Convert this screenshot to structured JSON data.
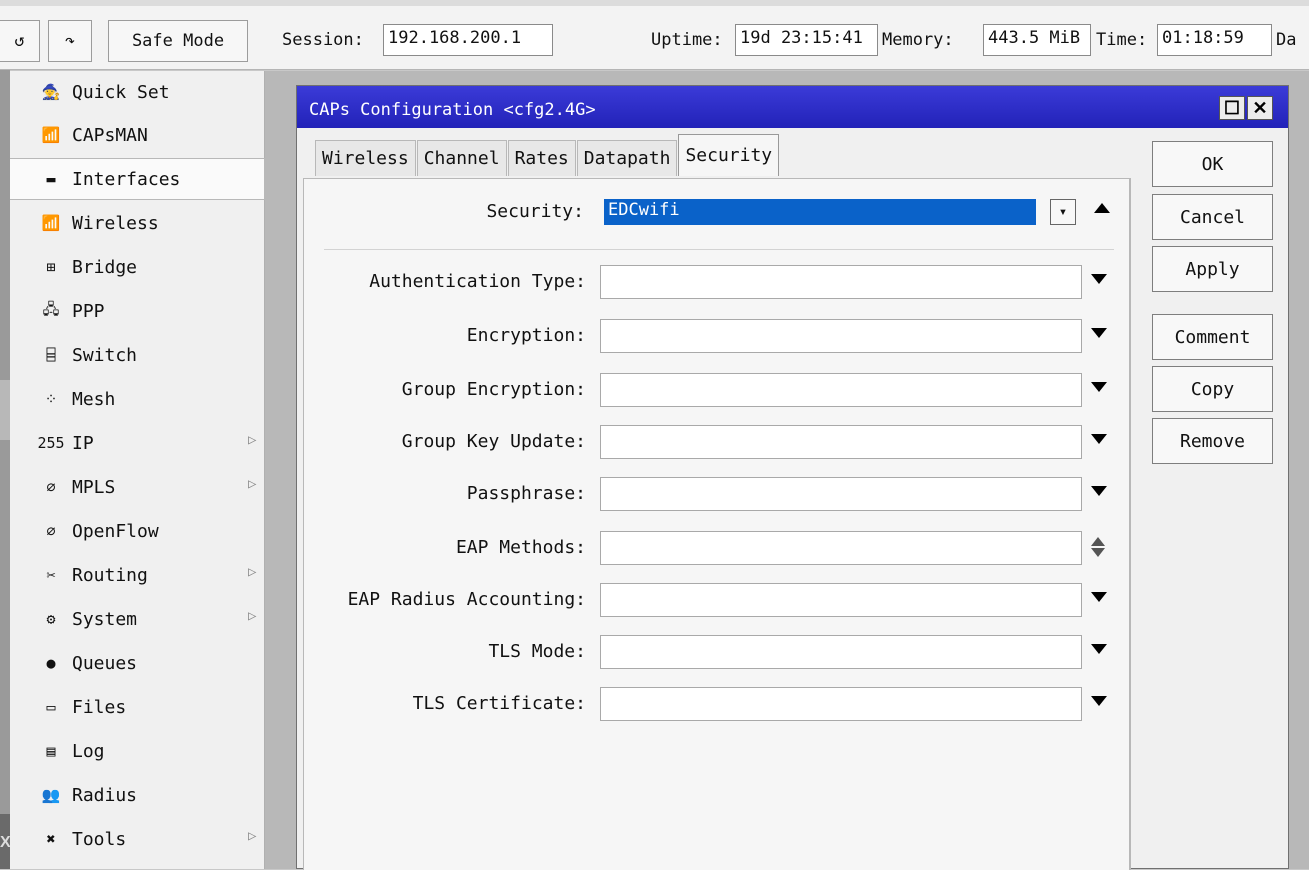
{
  "toolbar": {
    "undo_label": "↺",
    "redo_label": "↷",
    "safe_mode_label": "Safe Mode",
    "session_label": "Session:",
    "session_value": "192.168.200.1",
    "uptime_label": "Uptime:",
    "uptime_value": "19d 23:15:41",
    "memory_label": "Memory:",
    "memory_value": "443.5 MiB",
    "time_label": "Time:",
    "time_value": "01:18:59",
    "cut_label": "Da"
  },
  "sidebar": {
    "items": [
      {
        "label": "Quick Set",
        "icon": "quickset-icon",
        "glyph": "🧙",
        "submenu": false
      },
      {
        "label": "CAPsMAN",
        "icon": "capsman-icon",
        "glyph": "📶",
        "submenu": false
      },
      {
        "label": "Interfaces",
        "icon": "interfaces-icon",
        "glyph": "▬",
        "submenu": false
      },
      {
        "label": "Wireless",
        "icon": "wireless-icon",
        "glyph": "📶",
        "submenu": false
      },
      {
        "label": "Bridge",
        "icon": "bridge-icon",
        "glyph": "⊞",
        "submenu": false
      },
      {
        "label": "PPP",
        "icon": "ppp-icon",
        "glyph": "🖧",
        "submenu": false
      },
      {
        "label": "Switch",
        "icon": "switch-icon",
        "glyph": "⌸",
        "submenu": false
      },
      {
        "label": "Mesh",
        "icon": "mesh-icon",
        "glyph": "⁘",
        "submenu": false
      },
      {
        "label": "IP",
        "icon": "ip-icon",
        "glyph": "255",
        "submenu": true
      },
      {
        "label": "MPLS",
        "icon": "mpls-icon",
        "glyph": "∅",
        "submenu": true
      },
      {
        "label": "OpenFlow",
        "icon": "openflow-icon",
        "glyph": "∅",
        "submenu": false
      },
      {
        "label": "Routing",
        "icon": "routing-icon",
        "glyph": "✂",
        "submenu": true
      },
      {
        "label": "System",
        "icon": "system-icon",
        "glyph": "⚙",
        "submenu": true
      },
      {
        "label": "Queues",
        "icon": "queues-icon",
        "glyph": "●",
        "submenu": false
      },
      {
        "label": "Files",
        "icon": "files-icon",
        "glyph": "▭",
        "submenu": false
      },
      {
        "label": "Log",
        "icon": "log-icon",
        "glyph": "▤",
        "submenu": false
      },
      {
        "label": "Radius",
        "icon": "radius-icon",
        "glyph": "👥",
        "submenu": false
      },
      {
        "label": "Tools",
        "icon": "tools-icon",
        "glyph": "✖",
        "submenu": true
      }
    ],
    "selected": "Interfaces"
  },
  "dialog": {
    "title": "CAPs Configuration <cfg2.4G>",
    "max_glyph": "☐",
    "close_glyph": "✕",
    "tabs": [
      "Wireless",
      "Channel",
      "Rates",
      "Datapath",
      "Security"
    ],
    "active_tab": "Security",
    "security": {
      "label": "Security:",
      "value": "EDCwifi",
      "dd_glyph": "▾"
    },
    "fields": [
      {
        "label": "Authentication Type:",
        "value": "",
        "control": "dropdown"
      },
      {
        "label": "Encryption:",
        "value": "",
        "control": "dropdown"
      },
      {
        "label": "Group Encryption:",
        "value": "",
        "control": "dropdown"
      },
      {
        "label": "Group Key Update:",
        "value": "",
        "control": "dropdown"
      },
      {
        "label": "Passphrase:",
        "value": "",
        "control": "dropdown"
      },
      {
        "label": "EAP Methods:",
        "value": "",
        "control": "updown"
      },
      {
        "label": "EAP Radius Accounting:",
        "value": "",
        "control": "dropdown"
      },
      {
        "label": "TLS Mode:",
        "value": "",
        "control": "dropdown"
      },
      {
        "label": "TLS Certificate:",
        "value": "",
        "control": "dropdown"
      }
    ],
    "buttons": [
      "OK",
      "Cancel",
      "Apply",
      "Comment",
      "Copy",
      "Remove"
    ]
  },
  "colors": {
    "titlebar": "#2a2ac8",
    "selection": "#0a62c9"
  }
}
